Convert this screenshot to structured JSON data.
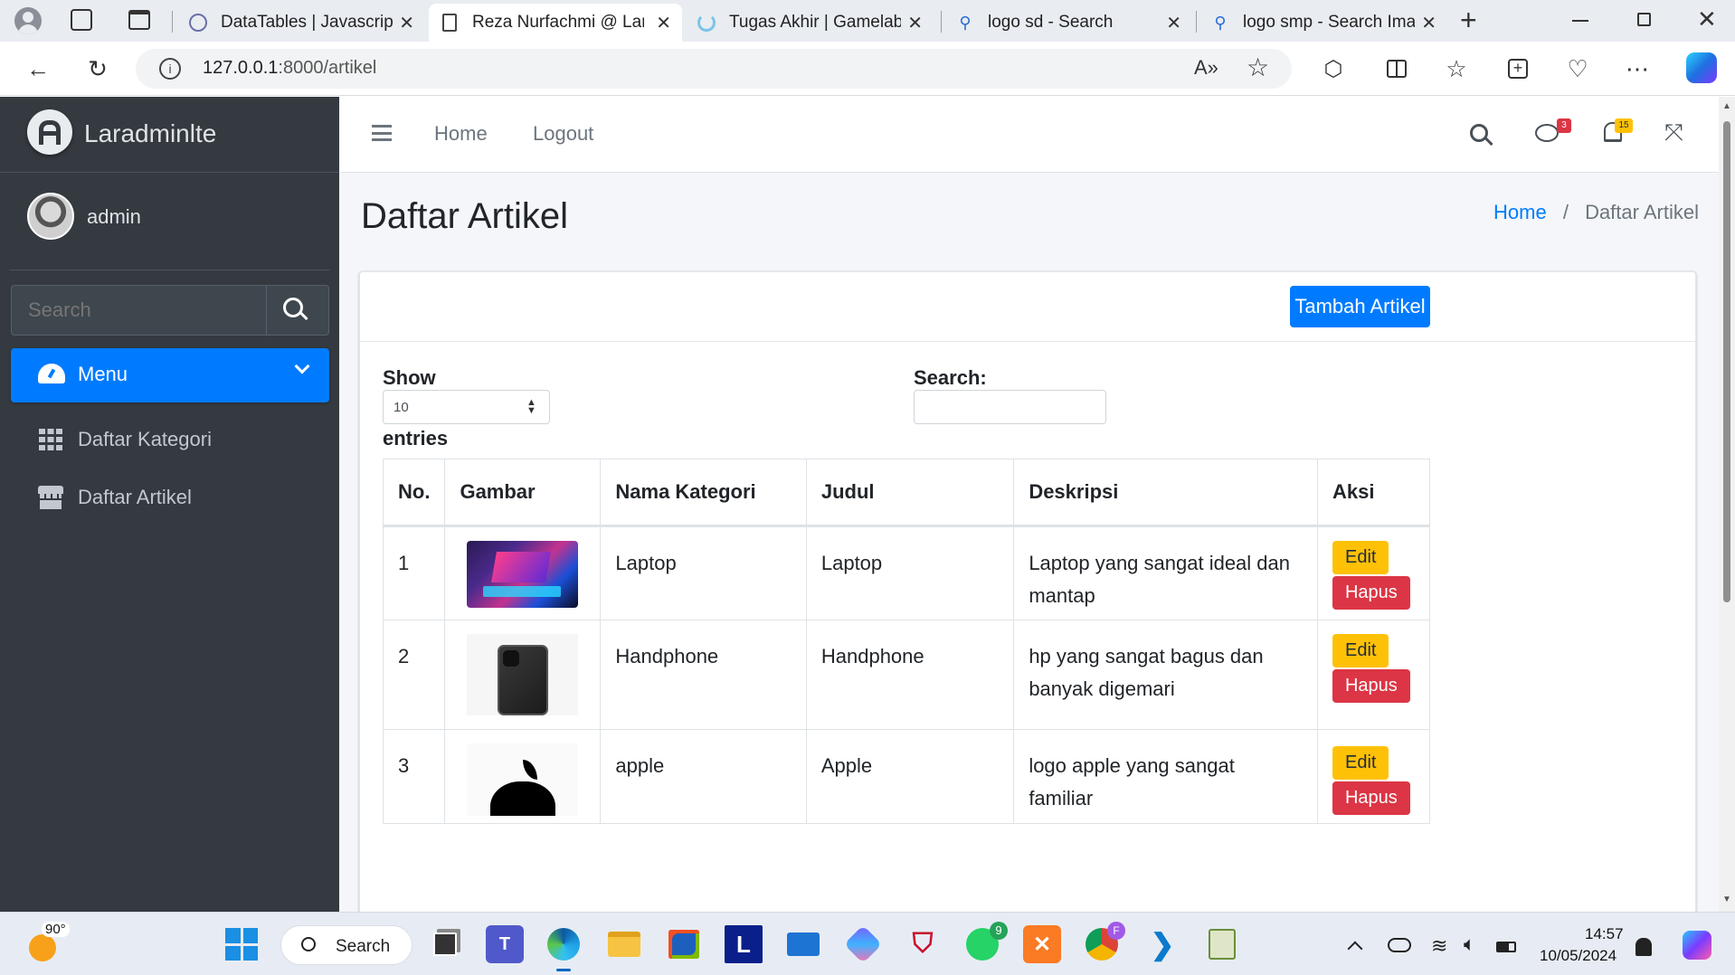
{
  "browser": {
    "tabs": [
      {
        "label": "DataTables | Javascript t"
      },
      {
        "label": "Reza Nurfachmi @ Lara"
      },
      {
        "label": "Tugas Akhir | Gamelab."
      },
      {
        "label": "logo sd - Search"
      },
      {
        "label": "logo smp - Search Imag"
      }
    ],
    "url_host": "127.0.0.1",
    "url_path": ":8000/artikel"
  },
  "sidebar": {
    "brand": "Laradminlte",
    "user": "admin",
    "search_placeholder": "Search",
    "menu_label": "Menu",
    "items": [
      {
        "label": "Daftar Kategori"
      },
      {
        "label": "Daftar Artikel"
      }
    ]
  },
  "topnav": {
    "home": "Home",
    "logout": "Logout",
    "messages_count": "3",
    "notifications_count": "15"
  },
  "page": {
    "title": "Daftar Artikel",
    "breadcrumb_home": "Home",
    "breadcrumb_sep": "/",
    "breadcrumb_current": "Daftar Artikel",
    "add_button": "Tambah Artikel"
  },
  "datatable": {
    "show_label": "Show",
    "entries_value": "10",
    "entries_label": "entries",
    "search_label": "Search:",
    "columns": [
      "No.",
      "Gambar",
      "Nama Kategori",
      "Judul",
      "Deskripsi",
      "Aksi"
    ],
    "rows": [
      {
        "no": "1",
        "kategori": "Laptop",
        "judul": "Laptop",
        "deskripsi": "Laptop yang sangat ideal dan mantap"
      },
      {
        "no": "2",
        "kategori": "Handphone",
        "judul": "Handphone",
        "deskripsi": "hp yang sangat bagus dan banyak digemari"
      },
      {
        "no": "3",
        "kategori": "apple",
        "judul": "Apple",
        "deskripsi": "logo apple yang sangat familiar"
      }
    ],
    "edit_label": "Edit",
    "delete_label": "Hapus"
  },
  "taskbar": {
    "weather": "90°",
    "search": "Search",
    "time": "14:57",
    "date": "10/05/2024",
    "whatsapp_badge": "9"
  },
  "colors": {
    "primary": "#007bff",
    "sidebar": "#343a40",
    "warning": "#ffc107",
    "danger": "#dc3545"
  }
}
